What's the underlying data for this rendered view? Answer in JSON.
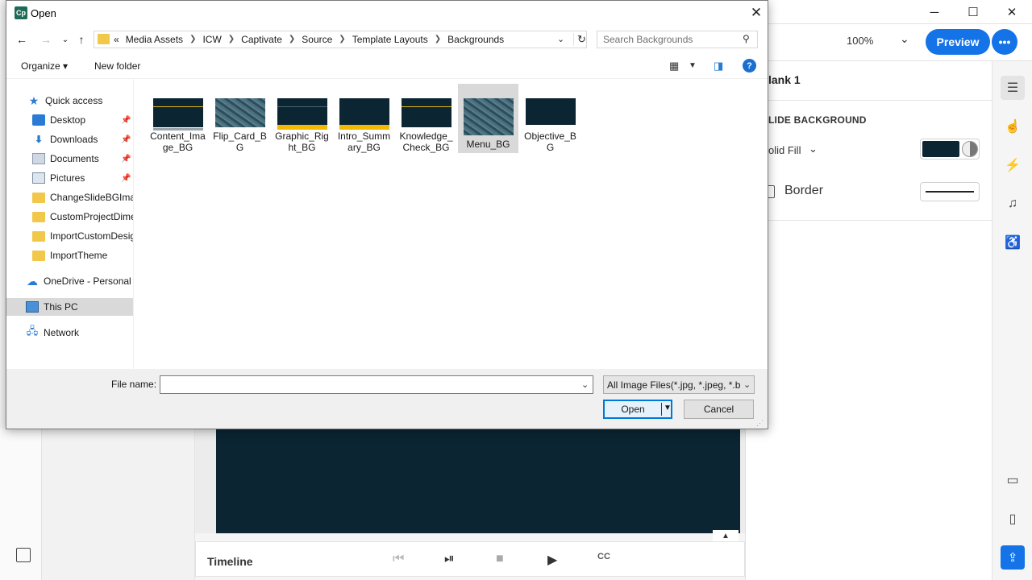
{
  "app": {
    "window_controls": {
      "minimize": "─",
      "maximize": "☐",
      "close": "✕"
    },
    "zoom": "100%",
    "preview_label": "Preview",
    "more_label": "•••",
    "properties": {
      "title": "lank 1",
      "section": "LIDE BACKGROUND",
      "fill_type": "olid Fill",
      "fill_color": "#0b2532",
      "border_label": "Border"
    },
    "timeline_label": "Timeline"
  },
  "dialog": {
    "title": "Open",
    "app_icon_label": "Cp",
    "breadcrumb_overflow": "«",
    "breadcrumbs": [
      "Media Assets",
      "ICW",
      "Captivate",
      "Source",
      "Template Layouts",
      "Backgrounds"
    ],
    "search_placeholder": "Search Backgrounds",
    "organize_label": "Organize ▾",
    "new_folder_label": "New folder",
    "nav": [
      {
        "label": "Quick access",
        "icon": "star-icon"
      },
      {
        "label": "Desktop",
        "icon": "desktop-icon",
        "pinned": true
      },
      {
        "label": "Downloads",
        "icon": "download-icon",
        "pinned": true
      },
      {
        "label": "Documents",
        "icon": "documents-icon",
        "pinned": true
      },
      {
        "label": "Pictures",
        "icon": "pictures-icon",
        "pinned": true
      },
      {
        "label": "ChangeSlideBGImage",
        "icon": "folder-icon"
      },
      {
        "label": "CustomProjectDimensions",
        "icon": "folder-icon"
      },
      {
        "label": "ImportCustomDesign",
        "icon": "folder-icon"
      },
      {
        "label": "ImportTheme",
        "icon": "folder-icon"
      },
      {
        "label": "OneDrive - Personal",
        "icon": "cloud-icon"
      },
      {
        "label": "This PC",
        "icon": "pc-icon",
        "selected": true
      },
      {
        "label": "Network",
        "icon": "network-icon"
      }
    ],
    "files": [
      {
        "name": "Content_Image_BG",
        "thumb": "line-top-gray-bottom"
      },
      {
        "name": "Flip_Card_BG",
        "thumb": "stone"
      },
      {
        "name": "Graphic_Right_BG",
        "thumb": "yellow-bar"
      },
      {
        "name": "Intro_Summary_BG",
        "thumb": "yellow-bar"
      },
      {
        "name": "Knowledge_Check_BG",
        "thumb": "line-top"
      },
      {
        "name": "Menu_BG",
        "thumb": "stone",
        "selected": true
      },
      {
        "name": "Objective_BG",
        "thumb": "white-bar"
      }
    ],
    "file_name_label": "File name:",
    "file_name_value": "",
    "filter": "All Image Files(*.jpg, *.jpeg, *.b",
    "open_label": "Open",
    "cancel_label": "Cancel"
  }
}
